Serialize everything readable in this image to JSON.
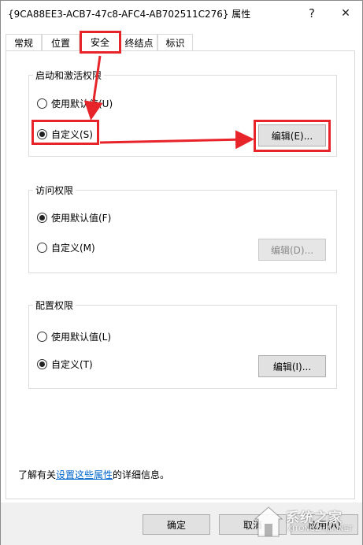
{
  "window": {
    "title": "{9CA88EE3-ACB7-47c8-AFC4-AB702511C276} 属性",
    "help_glyph": "?",
    "close_glyph": "✕"
  },
  "tabs": [
    {
      "label": "常规",
      "active": false
    },
    {
      "label": "位置",
      "active": false
    },
    {
      "label": "安全",
      "active": true
    },
    {
      "label": "终结点",
      "active": false
    },
    {
      "label": "标识",
      "active": false
    }
  ],
  "launch_group": {
    "title": "启动和激活权限",
    "default_label": "使用默认值(U)",
    "custom_label": "自定义(S)",
    "edit_label": "编辑(E)...",
    "selected": "custom"
  },
  "access_group": {
    "title": "访问权限",
    "default_label": "使用默认值(F)",
    "custom_label": "自定义(M)",
    "edit_label": "编辑(D)...",
    "selected": "default"
  },
  "config_group": {
    "title": "配置权限",
    "default_label": "使用默认值(L)",
    "custom_label": "自定义(T)",
    "edit_label": "编辑(I)...",
    "selected": "custom"
  },
  "footnote": {
    "prefix": "了解有关",
    "link": "设置这些属性",
    "suffix": "的详细信息。"
  },
  "buttons": {
    "ok": "确定",
    "cancel": "取消",
    "apply": "应用(A)"
  },
  "watermark": {
    "text": "系统之家",
    "sub": "XITONGZHIJIA.NET"
  },
  "colors": {
    "highlight": "#e8242b",
    "link": "#0066cc"
  }
}
